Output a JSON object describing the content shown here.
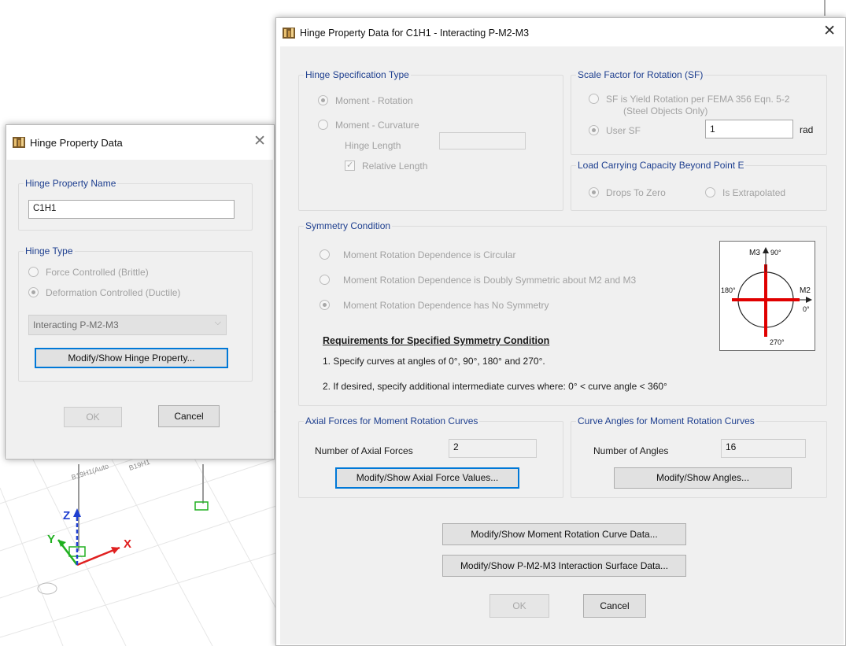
{
  "small_dialog": {
    "title": "Hinge Property Data",
    "name_group_label": "Hinge Property Name",
    "name_value": "C1H1",
    "type_group_label": "Hinge Type",
    "radio_force": "Force Controlled  (Brittle)",
    "radio_deformation": "Deformation Controlled  (Ductile)",
    "type_select_value": "Interacting P-M2-M3",
    "modify_button": "Modify/Show Hinge Property...",
    "ok_button": "OK",
    "cancel_button": "Cancel"
  },
  "main_dialog": {
    "title": "Hinge Property Data for C1H1 - Interacting P-M2-M3",
    "spec": {
      "label": "Hinge Specification Type",
      "moment_rotation": "Moment - Rotation",
      "moment_curvature": "Moment - Curvature",
      "hinge_length": "Hinge Length",
      "relative_length": "Relative Length"
    },
    "scale": {
      "label": "Scale Factor for Rotation (SF)",
      "sf_yield_line1": "SF is Yield Rotation per FEMA 356 Eqn. 5-2",
      "sf_yield_line2": "(Steel Objects Only)",
      "user_sf": "User SF",
      "user_sf_value": "1",
      "unit": "rad"
    },
    "load": {
      "label": "Load Carrying Capacity Beyond Point E",
      "drops": "Drops To Zero",
      "extrapolated": "Is Extrapolated"
    },
    "symmetry": {
      "label": "Symmetry Condition",
      "circular": "Moment Rotation Dependence is Circular",
      "doubly": "Moment Rotation Dependence is Doubly Symmetric about M2 and M3",
      "none": "Moment Rotation Dependence has No Symmetry",
      "req_title": "Requirements for Specified Symmetry Condition",
      "req1": "1.   Specify curves at angles of 0°, 90°, 180° and 270°.",
      "req2": "2.   If desired, specify additional intermediate curves where:   0° < curve angle < 360°",
      "diagram": {
        "m3_label": "M3",
        "angle_90": "90°",
        "angle_180": "180°",
        "m2_label": "M2",
        "angle_0": "0°",
        "angle_270": "270°"
      }
    },
    "axial": {
      "label": "Axial Forces for Moment Rotation Curves",
      "count_label": "Number of Axial Forces",
      "count_value": "2",
      "button": "Modify/Show Axial Force Values..."
    },
    "angles": {
      "label": "Curve Angles for Moment Rotation Curves",
      "count_label": "Number of Angles",
      "count_value": "16",
      "button": "Modify/Show Angles..."
    },
    "moment_curve_button": "Modify/Show Moment Rotation Curve Data...",
    "interaction_button": "Modify/Show P-M2-M3 Interaction Surface Data...",
    "ok_button": "OK",
    "cancel_button": "Cancel"
  },
  "background": {
    "frame_label_1": "B19H1(Auto",
    "frame_label_2": "B19H1",
    "axis_x": "X",
    "axis_y": "Y",
    "axis_z": "Z"
  },
  "colors": {
    "group_label": "#1e3f8f",
    "focus_border": "#0078d7",
    "axis_x": "#e02020",
    "axis_y": "#20b020",
    "axis_z": "#2040d0",
    "symmetry_cross": "#e00000"
  }
}
